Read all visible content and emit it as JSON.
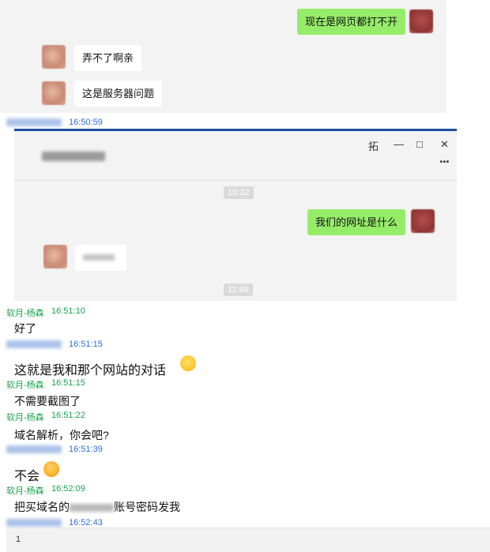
{
  "shot1": {
    "msg_me": "现在是网页都打不开",
    "msg_other_1": "弄不了啊亲",
    "msg_other_2": "这是服务器问题"
  },
  "log_time_1": "16:50:59",
  "shot2": {
    "window_controls": [
      "拓",
      "—",
      "□",
      "✕"
    ],
    "more": "⋮",
    "ts1": "10:32",
    "msg_me": "我们的网址是什么",
    "ts2": "11:48"
  },
  "log": [
    {
      "sender": "软月-杨森",
      "time": "16:51:10",
      "text": "好了"
    },
    {
      "time": "16:51:15",
      "text": "这就是我和那个网站的对话"
    },
    {
      "sender": "软月-杨森",
      "time": "16:51:15",
      "text": "不需要截图了"
    },
    {
      "sender": "软月-杨森",
      "time": "16:51:22",
      "text": "域名解析，你会吧?"
    },
    {
      "time": "16:51:39",
      "text": "不会"
    },
    {
      "sender": "软月-杨森",
      "time": "16:52:09",
      "text_before": "把买域名的",
      "text_after": "账号密码发我"
    },
    {
      "time": "16:52:43"
    }
  ],
  "input_value": "1"
}
